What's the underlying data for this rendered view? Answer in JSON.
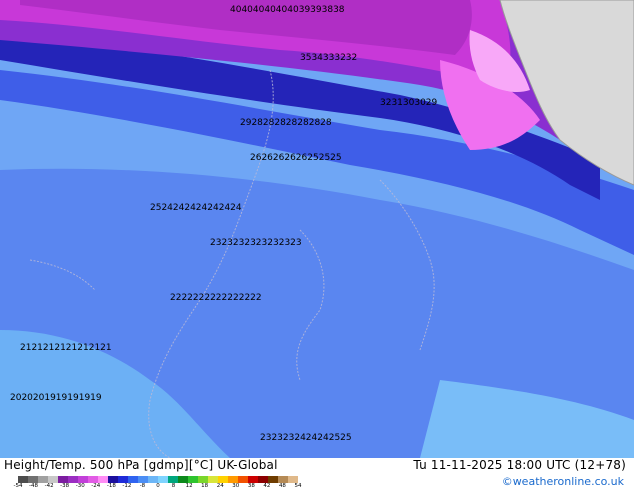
{
  "map": {
    "product_title": "Height/Temp. 500 hPa [gdmp][°C] UK-Global",
    "valid_time": "Tu 11-11-2025 18:00 UTC (12+78)",
    "credit": "©weatheronline.co.uk",
    "colorbar": {
      "ticks": [
        "-54",
        "-48",
        "-42",
        "-38",
        "-30",
        "-24",
        "-18",
        "-12",
        "-8",
        "0",
        "8",
        "12",
        "18",
        "24",
        "30",
        "38",
        "42",
        "48",
        "54"
      ],
      "colors": [
        "#4d4d4d",
        "#707070",
        "#a0a0a0",
        "#c8c8c8",
        "#7c1da0",
        "#9b2ec2",
        "#c23fd9",
        "#e25ce5",
        "#ff8cf5",
        "#1c0f9e",
        "#1f2bd8",
        "#2f63f0",
        "#4b8ef5",
        "#6cb6f7",
        "#7fd4ff",
        "#00a77e",
        "#0d8a1c",
        "#2ec42e",
        "#7ad62b",
        "#d8e63a",
        "#ffd200",
        "#ff9a00",
        "#f25200",
        "#cc0000",
        "#8c0000",
        "#6e3c00",
        "#b58a55",
        "#e0b98a"
      ]
    },
    "contour_labels": {
      "row_a": "40404040404039393838",
      "row_b": "3534333232",
      "row_c": "3231303029",
      "row_d": "2928282828282828",
      "row_e": "2626262626252525",
      "row_f": "2524242424242424",
      "row_g": "2323232323232323",
      "row_h": "2222222222222222",
      "row_i": "2121212121212121",
      "row_j": "2020201919191919",
      "row_k": "2323232424242525"
    },
    "palette": {
      "magenta": "#c838d8",
      "pink": "#f070f0",
      "light_pink": "#f8a8f8",
      "violet": "#8a2fd0",
      "dark_blue": "#1f22c8",
      "navy": "#2424b8",
      "mid_blue": "#3f5ee8",
      "blue": "#5a86f0",
      "light_blue": "#6fa6f5",
      "land": "#d9d9d9",
      "sea_outline": "#aaaaaa"
    }
  }
}
